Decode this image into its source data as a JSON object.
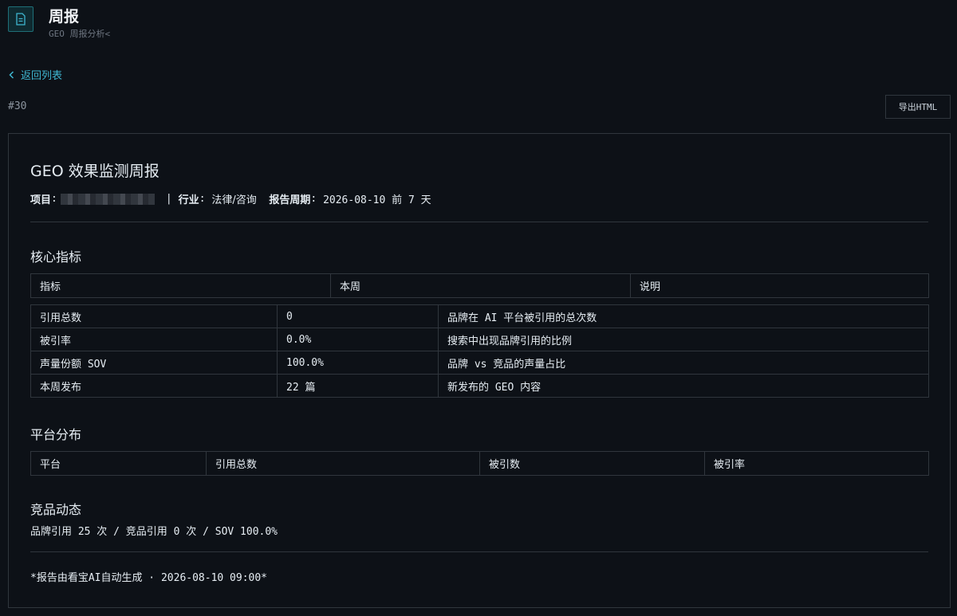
{
  "header": {
    "title": "周报",
    "subtitle": "GEO 周报分析<"
  },
  "nav": {
    "back_label": "返回列表"
  },
  "report_id": "#30",
  "toolbar": {
    "export_label": "导出HTML"
  },
  "report": {
    "title": "GEO 效果监测周报",
    "project_label": "项目",
    "industry_label": "行业",
    "industry_value": "法律/咨询",
    "period_label": "报告周期",
    "period_value": "2026-08-10 前 7 天"
  },
  "core_metrics": {
    "title": "核心指标",
    "headers": [
      "指标",
      "本周",
      "说明"
    ],
    "rows": [
      [
        "引用总数",
        "0",
        "品牌在 AI 平台被引用的总次数"
      ],
      [
        "被引率",
        "0.0%",
        "搜索中出现品牌引用的比例"
      ],
      [
        "声量份额 SOV",
        "100.0%",
        "品牌 vs 竞品的声量占比"
      ],
      [
        "本周发布",
        "22 篇",
        "新发布的 GEO 内容"
      ]
    ]
  },
  "platform": {
    "title": "平台分布",
    "headers": [
      "平台",
      "引用总数",
      "被引数",
      "被引率"
    ]
  },
  "competitor": {
    "title": "竞品动态",
    "summary": "品牌引用 25 次 / 竞品引用 0 次 / SOV 100.0%"
  },
  "footer": {
    "text": "*报告由看宝AI自动生成 · 2026-08-10 09:00*"
  }
}
